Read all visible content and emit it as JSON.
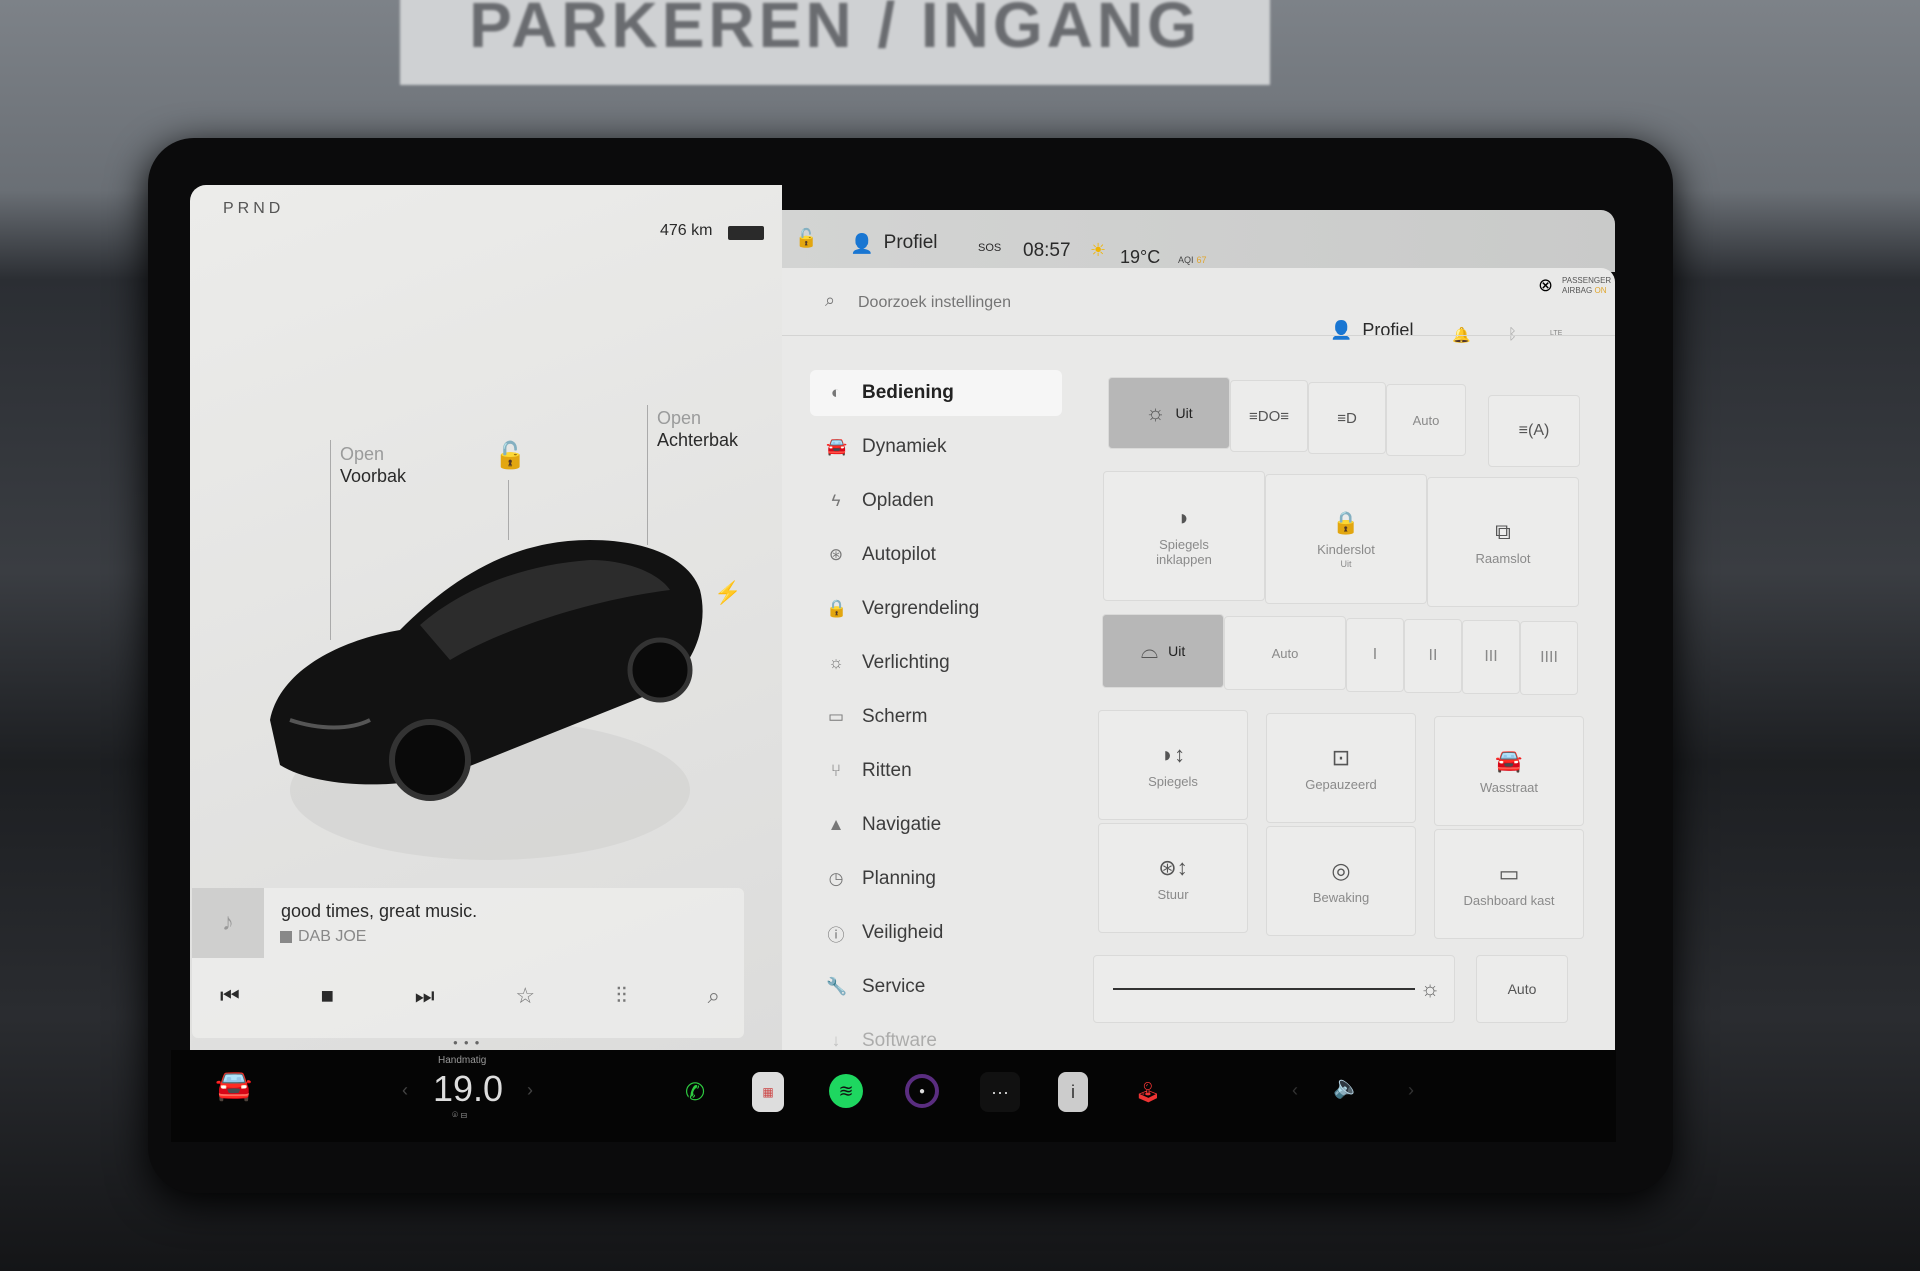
{
  "background_sign": "PARKEREN / INGANG",
  "left_panel": {
    "gear": "PRND",
    "range": "476 km",
    "frunk": {
      "line1": "Open",
      "line2": "Voorbak"
    },
    "trunk": {
      "line1": "Open",
      "line2": "Achterbak"
    },
    "media": {
      "title": "good times, great music.",
      "source": "DAB JOE",
      "controls": [
        "previous-icon",
        "stop-icon",
        "next-icon",
        "star-icon",
        "equalizer-icon",
        "search-icon"
      ]
    }
  },
  "status_bar": {
    "profile": "Profiel",
    "sos": "SOS",
    "time": "08:57",
    "temperature": "19°C",
    "aqi_label": "AQI",
    "aqi_value": "67",
    "airbag_line1": "PASSENGER",
    "airbag_line2": "AIRBAG",
    "airbag_state": "ON"
  },
  "settings": {
    "search_placeholder": "Doorzoek instellingen",
    "profile": "Profiel",
    "lte": "LTE",
    "menu": [
      {
        "label": "Bediening",
        "icon": "toggle-icon",
        "active": true
      },
      {
        "label": "Dynamiek",
        "icon": "car-icon"
      },
      {
        "label": "Opladen",
        "icon": "bolt-icon"
      },
      {
        "label": "Autopilot",
        "icon": "steering-wheel-icon"
      },
      {
        "label": "Vergrendeling",
        "icon": "lock-icon"
      },
      {
        "label": "Verlichting",
        "icon": "light-icon"
      },
      {
        "label": "Scherm",
        "icon": "display-icon"
      },
      {
        "label": "Ritten",
        "icon": "trips-icon"
      },
      {
        "label": "Navigatie",
        "icon": "navigation-icon"
      },
      {
        "label": "Planning",
        "icon": "clock-icon"
      },
      {
        "label": "Veiligheid",
        "icon": "alert-icon"
      },
      {
        "label": "Service",
        "icon": "wrench-icon"
      },
      {
        "label": "Software",
        "icon": "download-icon"
      }
    ],
    "lights": {
      "off": "Uit",
      "auto": "Auto"
    },
    "tiles_row1": [
      {
        "label": "Spiegels inklappen",
        "sub": ""
      },
      {
        "label": "Kinderslot",
        "sub": "Uit"
      },
      {
        "label": "Raamslot",
        "sub": ""
      }
    ],
    "wipers": {
      "off": "Uit",
      "auto": "Auto",
      "speeds": [
        "I",
        "II",
        "III",
        "IIII"
      ]
    },
    "tiles_row2": [
      "Spiegels",
      "Gepauzeerd",
      "Wasstraat",
      "Stuur",
      "Bewaking",
      "Dashboard kast"
    ],
    "brightness": {
      "auto": "Auto",
      "level_percent": 100
    }
  },
  "bottom_bar": {
    "climate_mode": "Handmatig",
    "temperature": "19.0",
    "apps": [
      "phone-icon",
      "calendar-icon",
      "spotify-icon",
      "camera-icon",
      "more-icon",
      "manual-icon",
      "joystick-icon"
    ],
    "colors": {
      "phone": "#2ecc40",
      "spotify": "#1ed760"
    }
  }
}
